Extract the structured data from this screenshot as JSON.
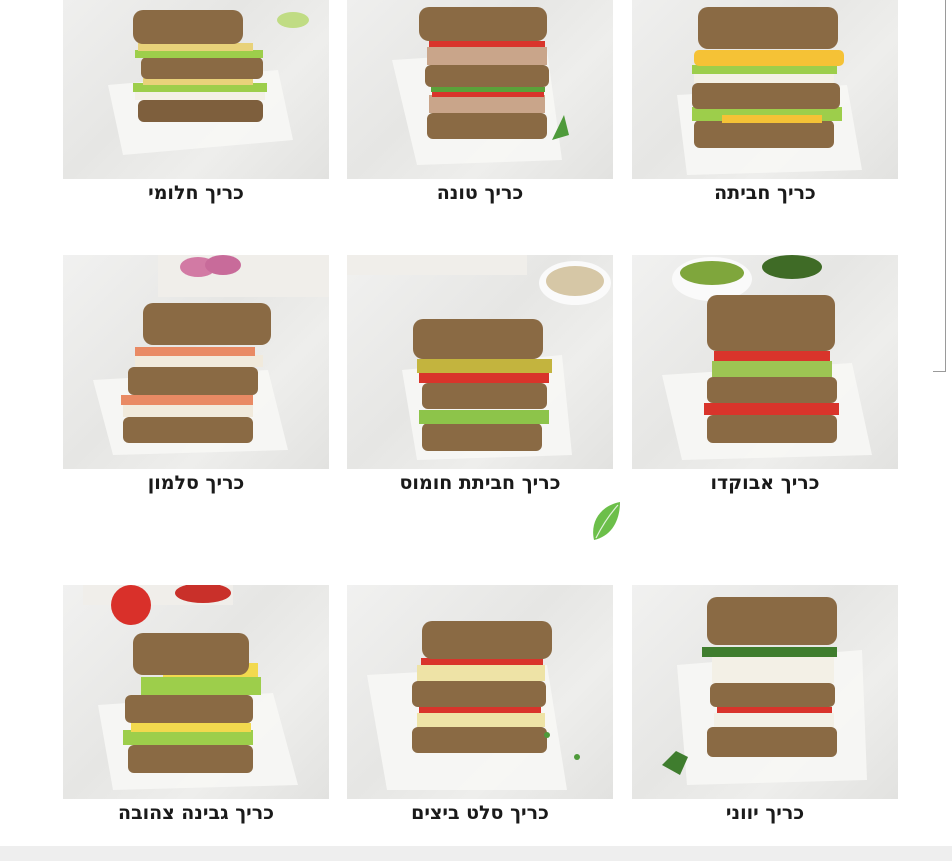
{
  "menu": {
    "rows": [
      {
        "items": [
          {
            "name": "כריך חלומי",
            "image_icon": "halloumi-sandwich-photo"
          },
          {
            "name": "כריך טונה",
            "image_icon": "tuna-sandwich-photo"
          },
          {
            "name": "כריך חביתה",
            "image_icon": "omelette-sandwich-photo"
          }
        ]
      },
      {
        "items": [
          {
            "name": "כריך סלמון",
            "image_icon": "salmon-sandwich-photo"
          },
          {
            "name": "כריך חביתת חומוס",
            "image_icon": "chickpea-omelette-sandwich-photo"
          },
          {
            "name": "כריך אבוקדו",
            "image_icon": "avocado-sandwich-photo"
          }
        ]
      },
      {
        "items": [
          {
            "name": "כריך גבינה צהובה",
            "image_icon": "yellow-cheese-sandwich-photo"
          },
          {
            "name": "כריך סלט ביצים",
            "image_icon": "egg-salad-sandwich-photo"
          },
          {
            "name": "כריך יווני",
            "image_icon": "greek-sandwich-photo"
          }
        ]
      }
    ]
  },
  "decor": {
    "leaf_icon": "leaf-icon"
  },
  "colors": {
    "bread": "#8a6a44",
    "lettuce": "#8cc63f",
    "tomato": "#d9342b",
    "leaf": "#6cbf4a"
  }
}
